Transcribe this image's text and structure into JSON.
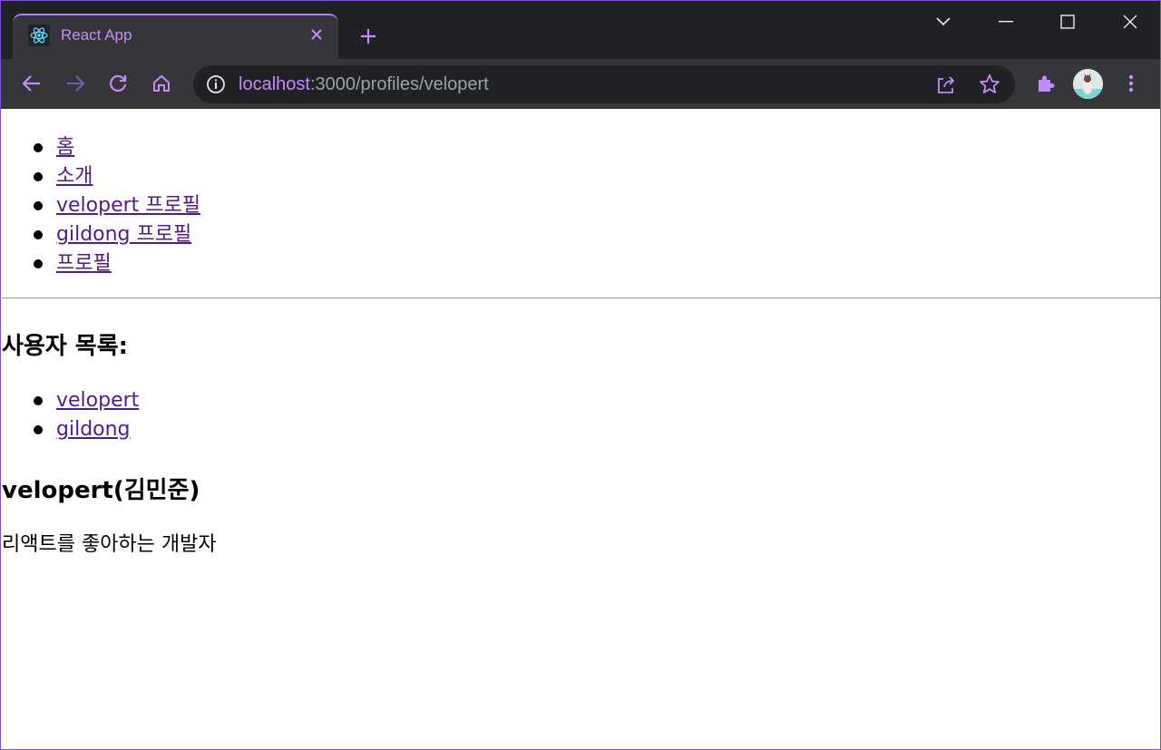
{
  "browser": {
    "tab": {
      "title": "React App",
      "favicon": "react-atom-icon"
    },
    "address_bar": {
      "host": "localhost",
      "path": ":3000/profiles/velopert"
    },
    "colors": {
      "accent": "#c58af9",
      "frame": "#202124",
      "toolbar": "#35363a"
    }
  },
  "page": {
    "nav_links": [
      {
        "label": "홈"
      },
      {
        "label": "소개"
      },
      {
        "label": "velopert 프로필"
      },
      {
        "label": "gildong 프로필"
      },
      {
        "label": "프로필"
      }
    ],
    "user_list_title": "사용자 목록:",
    "users": [
      {
        "label": "velopert"
      },
      {
        "label": "gildong"
      }
    ],
    "profile": {
      "title": "velopert(김민준)",
      "description": "리액트를 좋아하는 개발자"
    }
  }
}
